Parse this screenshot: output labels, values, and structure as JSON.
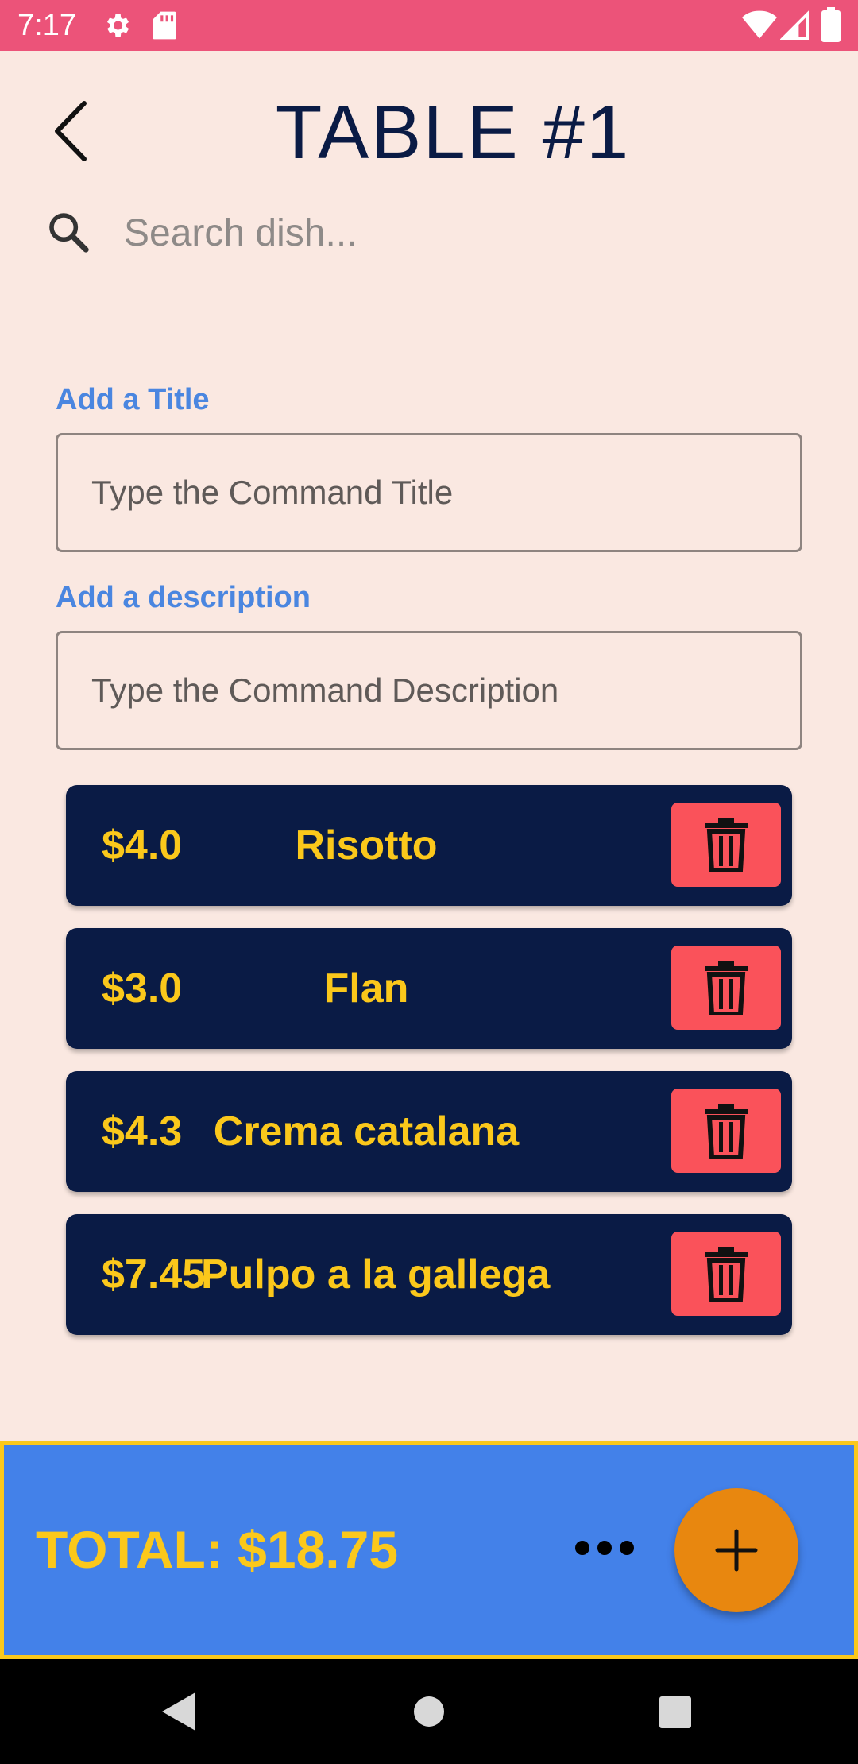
{
  "status_bar": {
    "time": "7:17",
    "icons": [
      "gear-icon",
      "sd-card-icon",
      "wifi-icon",
      "signal-icon",
      "battery-icon"
    ]
  },
  "header": {
    "title": "TABLE #1",
    "back_icon": "chevron-left-icon"
  },
  "search": {
    "placeholder": "Search dish...",
    "icon": "search-icon"
  },
  "form": {
    "title_label": "Add a Title",
    "title_placeholder": "Type the Command Title",
    "description_label": "Add a description",
    "description_placeholder": "Type the Command Description"
  },
  "dishes": [
    {
      "price": "$4.0",
      "name": "Risotto"
    },
    {
      "price": "$3.0",
      "name": "Flan"
    },
    {
      "price": "$4.3",
      "name": "Crema catalana"
    },
    {
      "price": "$7.45",
      "name": "Pulpo a la gallega"
    }
  ],
  "footer": {
    "total": "TOTAL: $18.75",
    "more_icon": "more-horizontal-icon",
    "add_icon": "plus-icon"
  },
  "colors": {
    "status_bar": "#ec5379",
    "background": "#fae8e1",
    "title": "#0a1b45",
    "label": "#4a86e0",
    "card": "#0a1b45",
    "card_text": "#fbc81b",
    "delete": "#fa525a",
    "bottom_bar": "#4381e9",
    "fab": "#e8870f"
  }
}
